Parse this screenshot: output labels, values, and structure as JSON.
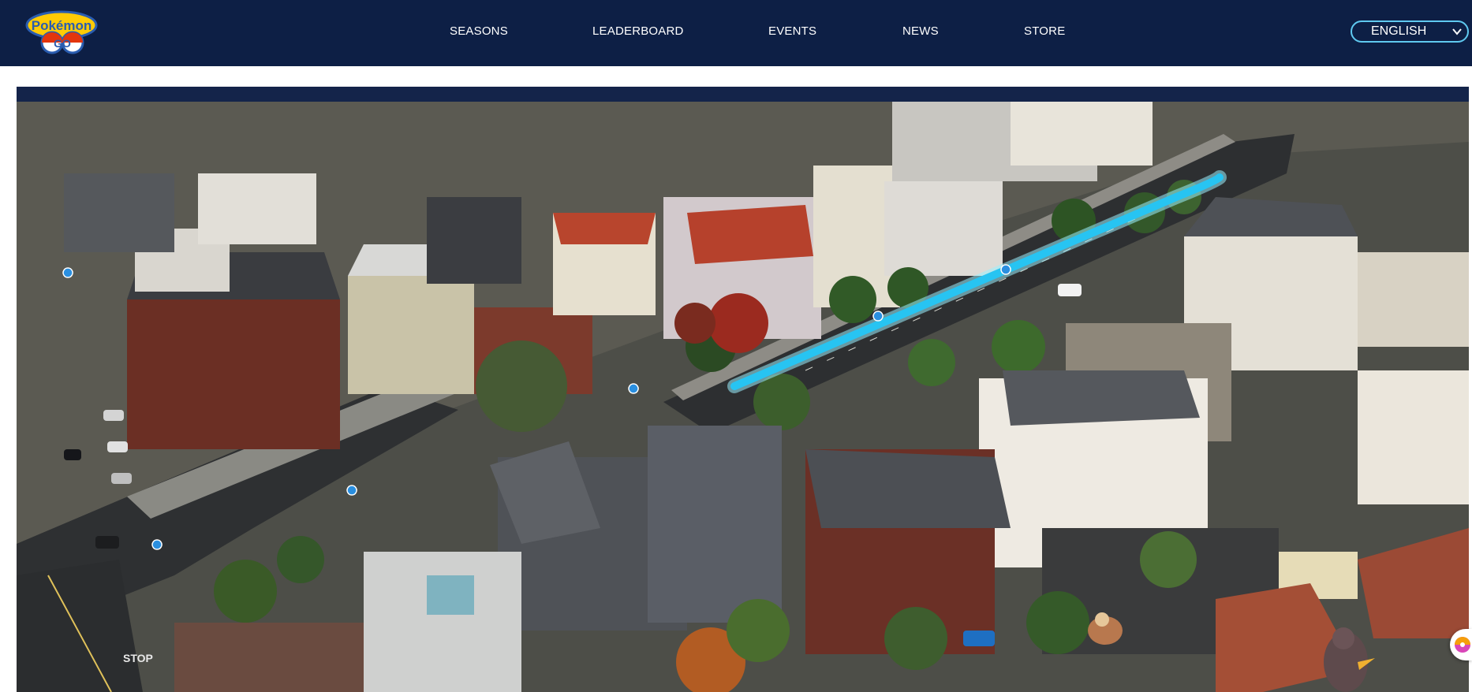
{
  "header": {
    "logo_alt": "Pokémon GO",
    "logo_top": "Pokémon",
    "logo_bottom": "GO",
    "nav": [
      {
        "label": "SEASONS"
      },
      {
        "label": "LEADERBOARD"
      },
      {
        "label": "EVENTS"
      },
      {
        "label": "NEWS"
      },
      {
        "label": "STORE"
      }
    ],
    "language": {
      "selected": "ENGLISH",
      "icon": "chevron-down-icon"
    }
  },
  "hero": {
    "description": "",
    "route_color": "#27c4f2",
    "pin_icon": "map-pin-icon",
    "street_marking": "STOP"
  },
  "side_widget": {
    "icon": "pokeball-icon"
  },
  "colors": {
    "header_bg": "#0d1f45",
    "nav_text": "#ffffff",
    "language_border": "#5fc9f0",
    "band": "#14244a"
  }
}
